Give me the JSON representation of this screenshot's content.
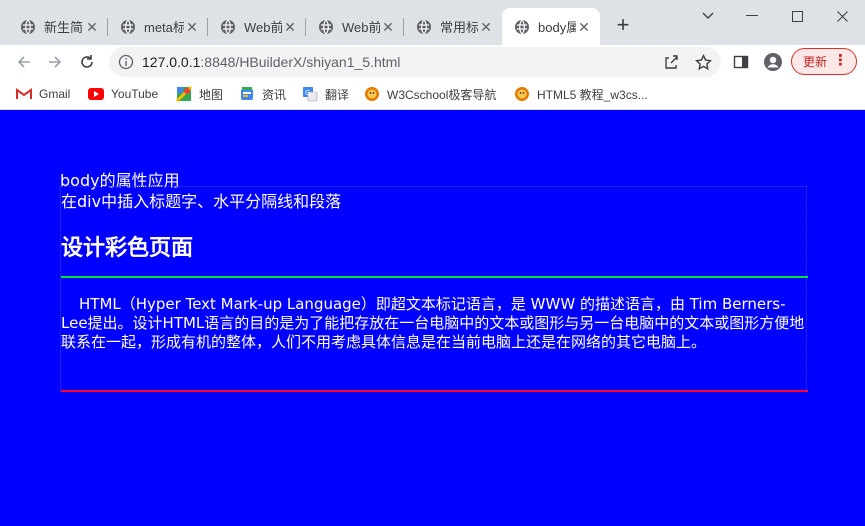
{
  "tabs": [
    {
      "label": "新生简",
      "active": false
    },
    {
      "label": "meta标",
      "active": false
    },
    {
      "label": "Web前",
      "active": false
    },
    {
      "label": "Web前",
      "active": false
    },
    {
      "label": "常用标",
      "active": false
    },
    {
      "label": "body属",
      "active": true
    }
  ],
  "toolbar": {
    "url_host": "127.0.0.1",
    "url_path": ":8848/HBuilderX/shiyan1_5.html",
    "update_label": "更新"
  },
  "bookmarks": [
    {
      "label": "Gmail",
      "icon": "gmail-icon"
    },
    {
      "label": "YouTube",
      "icon": "youtube-icon"
    },
    {
      "label": "地图",
      "icon": "maps-icon"
    },
    {
      "label": "资讯",
      "icon": "news-icon"
    },
    {
      "label": "翻译",
      "icon": "translate-icon"
    },
    {
      "label": "W3Cschool极客导航",
      "icon": "w3cschool-icon"
    },
    {
      "label": "HTML5 教程_w3cs...",
      "icon": "w3cschool-icon"
    }
  ],
  "page": {
    "body_text": "body的属性应用",
    "div_text": "在div中插入标题字、水平分隔线和段落",
    "heading": "设计彩色页面",
    "paragraph": "HTML（Hyper Text Mark-up Language）即超文本标记语言，是 WWW 的描述语言，由 Tim Berners-Lee提出。设计HTML语言的目的是为了能把存放在一台电脑中的文本或图形与另一台电脑中的文本或图形方便地联系在一起，形成有机的整体，人们不用考虑具体信息是在当前电脑上还是在网络的其它电脑上。",
    "background": "#0000ff",
    "text_color": "#ffffff",
    "hr1_color": "#00e040",
    "hr2_color": "#ff0030"
  }
}
